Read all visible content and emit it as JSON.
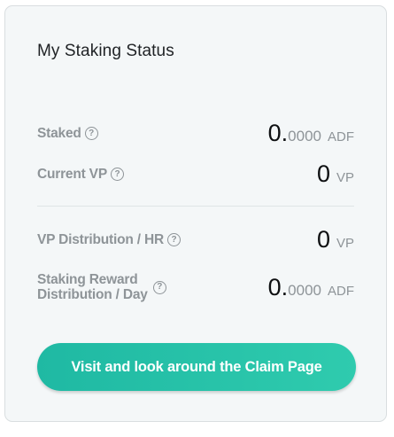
{
  "card": {
    "title": "My Staking Status"
  },
  "rows": [
    {
      "label": "Staked",
      "int": "0.",
      "dec": "0000",
      "unit": "ADF"
    },
    {
      "label": "Current VP",
      "int": "0",
      "dec": "",
      "unit": "VP"
    },
    {
      "label": "VP Distribution / HR",
      "int": "0",
      "dec": "",
      "unit": "VP"
    },
    {
      "label_line1": "Staking Reward",
      "label_line2": "Distribution / Day",
      "int": "0.",
      "dec": "0000",
      "unit": "ADF"
    }
  ],
  "help_icon": {
    "glyph": "?",
    "name": "help-circle-icon"
  },
  "button": {
    "label": "Visit and look around the Claim Page"
  },
  "colors": {
    "card_bg": "#f4f7f8",
    "muted_text": "#8e9498",
    "accent_start": "#1fb9a3",
    "accent_end": "#2fcbae"
  }
}
